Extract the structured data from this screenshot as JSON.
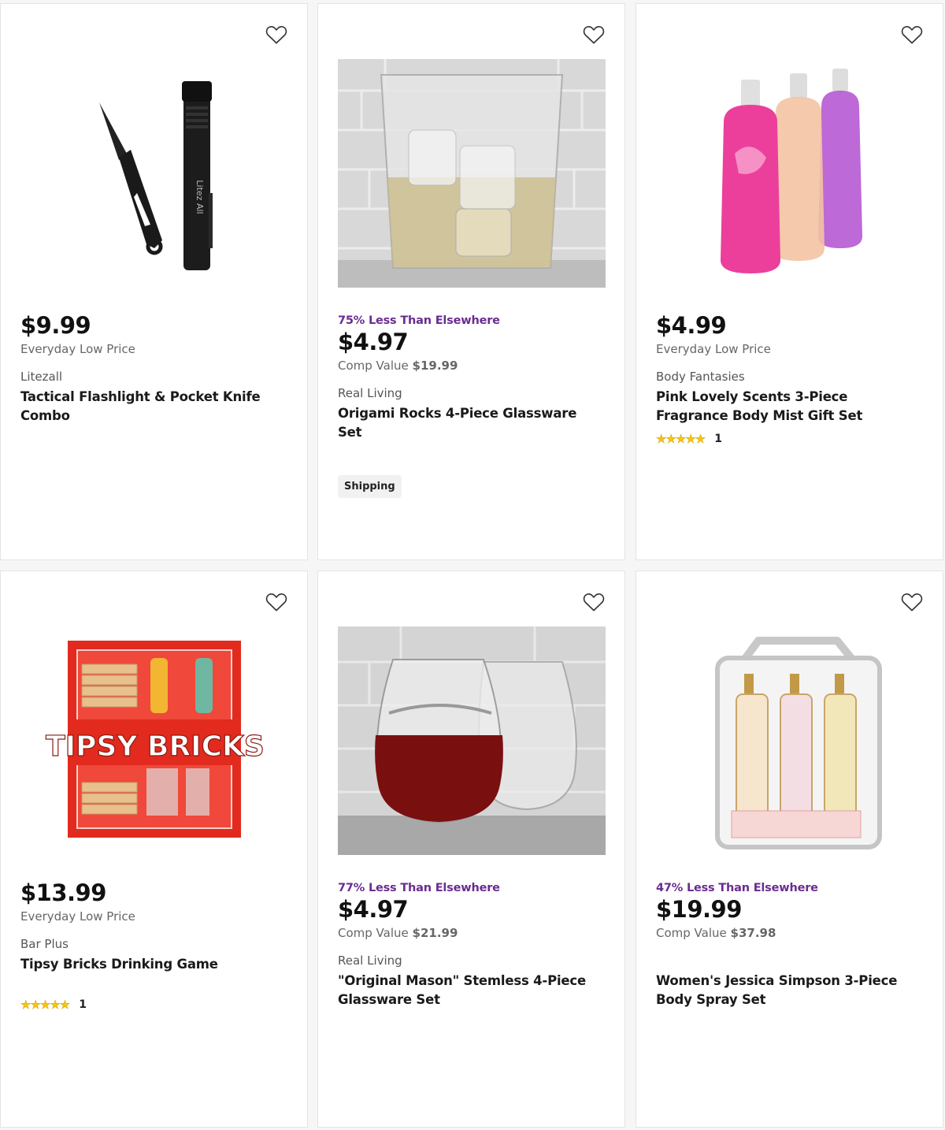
{
  "products": [
    {
      "image_icon": "flashlight-knife-image",
      "less_label": "",
      "price": "$9.99",
      "price_sub": "Everyday Low Price",
      "brand": "Litezall",
      "name": "Tactical Flashlight & Pocket Knife Combo"
    },
    {
      "image_icon": "glass-tumbler-image",
      "less_label": "75% Less Than Elsewhere",
      "price": "$4.97",
      "price_sub_prefix": "Comp Value",
      "price_sub_value": "$19.99",
      "brand": "Real Living",
      "name": "Origami Rocks 4-Piece Glassware Set",
      "badge": "Shipping"
    },
    {
      "image_icon": "body-mist-bottles-image",
      "less_label": "",
      "price": "$4.99",
      "price_sub": "Everyday Low Price",
      "brand": "Body Fantasies",
      "name": "Pink Lovely Scents 3-Piece Fragrance Body Mist Gift Set",
      "rating_count": "1"
    },
    {
      "image_icon": "tipsy-bricks-box-image",
      "image_text": "TIPSY BRICKS",
      "less_label": "",
      "price": "$13.99",
      "price_sub": "Everyday Low Price",
      "brand": "Bar Plus",
      "name": "Tipsy Bricks Drinking Game",
      "rating_count": "1"
    },
    {
      "image_icon": "mason-glasses-image",
      "less_label": "77% Less Than Elsewhere",
      "price": "$4.97",
      "price_sub_prefix": "Comp Value",
      "price_sub_value": "$21.99",
      "brand": "Real Living",
      "name": "\"Original Mason\" Stemless 4-Piece Glassware Set"
    },
    {
      "image_icon": "body-spray-set-image",
      "less_label": "47% Less Than Elsewhere",
      "price": "$19.99",
      "price_sub_prefix": "Comp Value",
      "price_sub_value": "$37.98",
      "brand": "",
      "name": "Women's Jessica Simpson 3-Piece Body Spray Set"
    }
  ],
  "rating_stars": 5,
  "colors": {
    "accent_purple": "#6a2c91",
    "star_yellow": "#f5c518",
    "card_border": "#e4e4e4"
  }
}
